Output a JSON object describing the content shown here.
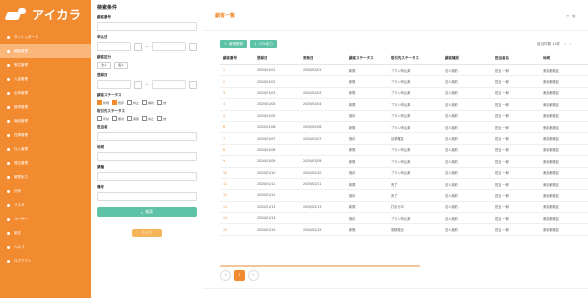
{
  "sidebar": {
    "brand": "アイカラ",
    "items": [
      {
        "label": "ダッシュボード",
        "active": false
      },
      {
        "label": "顧客管理",
        "active": true
      },
      {
        "label": "受注管理",
        "active": false
      },
      {
        "label": "入金管理",
        "active": false
      },
      {
        "label": "出荷管理",
        "active": false
      },
      {
        "label": "請求管理",
        "active": false
      },
      {
        "label": "商品管理",
        "active": false
      },
      {
        "label": "在庫管理",
        "active": false
      },
      {
        "label": "仕入管理",
        "active": false
      },
      {
        "label": "発注管理",
        "active": false
      },
      {
        "label": "帳票出力",
        "active": false
      },
      {
        "label": "分析",
        "active": false
      },
      {
        "label": "マスタ",
        "active": false
      },
      {
        "label": "ユーザー",
        "active": false
      },
      {
        "label": "設定",
        "active": false
      },
      {
        "label": "ヘルプ",
        "active": false
      },
      {
        "label": "ログアウト",
        "active": false
      }
    ]
  },
  "filter": {
    "title": "検索条件",
    "fields": [
      {
        "label": "顧客番号",
        "placeholder": ""
      },
      {
        "label": "申込日",
        "placeholder": "",
        "range": true
      },
      {
        "label": "顧客区分",
        "chips": [
          "法人",
          "個人"
        ]
      },
      {
        "label": "登録日",
        "placeholder": "",
        "range": true
      },
      {
        "label": "顧客ステータス",
        "checks": [
          {
            "label": "新規",
            "on": true
          },
          {
            "label": "既存",
            "on": true
          },
          {
            "label": "休止",
            "on": false
          },
          {
            "label": "解約",
            "on": false
          },
          {
            "label": "他",
            "on": false
          }
        ]
      },
      {
        "label": "取引先ステータス",
        "checks": [
          {
            "label": "有効",
            "on": false
          },
          {
            "label": "無効",
            "on": false
          },
          {
            "label": "保留",
            "on": false
          },
          {
            "label": "停止",
            "on": false
          },
          {
            "label": "他",
            "on": false
          }
        ]
      },
      {
        "label": "担当者",
        "placeholder": ""
      },
      {
        "label": "地域",
        "placeholder": ""
      },
      {
        "label": "業種",
        "placeholder": ""
      },
      {
        "label": "備考",
        "placeholder": ""
      }
    ],
    "search_label": "検索",
    "clear_label": "クリア"
  },
  "main": {
    "title": "顧客一覧",
    "top_right": [
      "≡",
      "◐"
    ],
    "register_label": "新規登録",
    "csv_label": "CSV出力",
    "count_text": "該当件数 15件",
    "columns": [
      "顧客番号",
      "登録日",
      "更新日",
      "顧客ステータス",
      "取引先ステータス",
      "顧客種別",
      "担当者名",
      "地域"
    ],
    "rows": [
      [
        "1",
        "2020/01/01",
        "2020/02/01",
        "新規",
        "プラン申込済",
        "法人契約",
        "担当 一郎",
        "東京都港区"
      ],
      [
        "2",
        "2020/01/02",
        "",
        "新規",
        "プラン申込済",
        "法人契約",
        "担当 一郎",
        "東京都港区"
      ],
      [
        "3",
        "2020/01/03",
        "2020/02/03",
        "新規",
        "プラン申込済",
        "法人契約",
        "担当 一郎",
        "東京都港区"
      ],
      [
        "4",
        "2020/01/04",
        "2020/02/04",
        "新規",
        "プラン申込済",
        "法人契約",
        "担当 一郎",
        "東京都港区"
      ],
      [
        "5",
        "2020/01/05",
        "",
        "既存",
        "プラン申込済",
        "法人契約",
        "担当 一郎",
        "東京都港区"
      ],
      [
        "6",
        "2020/01/06",
        "2020/02/06",
        "新規",
        "プラン申込済",
        "法人契約",
        "担当 一郎",
        "東京都港区"
      ],
      [
        "7",
        "2020/01/07",
        "2020/02/07",
        "既存",
        "請求確定",
        "法人契約",
        "担当 一郎",
        "東京都港区"
      ],
      [
        "8",
        "2020/01/08",
        "",
        "新規",
        "プラン申込済",
        "法人契約",
        "担当 一郎",
        "東京都港区"
      ],
      [
        "9",
        "2020/01/09",
        "2020/02/09",
        "新規",
        "プラン申込済",
        "法人契約",
        "担当 一郎",
        "東京都港区"
      ],
      [
        "10",
        "2020/01/10",
        "2020/02/10",
        "既存",
        "プラン申込済",
        "法人契約",
        "担当 一郎",
        "東京都港区"
      ],
      [
        "11",
        "2020/01/11",
        "2020/02/11",
        "新規",
        "完了",
        "法人契約",
        "担当 一郎",
        "東京都港区"
      ],
      [
        "12",
        "2020/01/12",
        "",
        "既存",
        "完了",
        "法人契約",
        "担当 一郎",
        "東京都港区"
      ],
      [
        "13",
        "2020/01/13",
        "2020/02/13",
        "新規",
        "打合せ中",
        "法人契約",
        "担当 一郎",
        "東京都港区"
      ],
      [
        "14",
        "2020/01/14",
        "",
        "既存",
        "プラン申込済",
        "法人契約",
        "担当 一郎",
        "東京都港区"
      ],
      [
        "15",
        "2020/01/15",
        "2020/02/15",
        "新規",
        "見積提出",
        "法人契約",
        "担当 一郎",
        "東京都港区"
      ]
    ],
    "pagination": {
      "prev": "<",
      "current": "1",
      "next": ">"
    }
  }
}
